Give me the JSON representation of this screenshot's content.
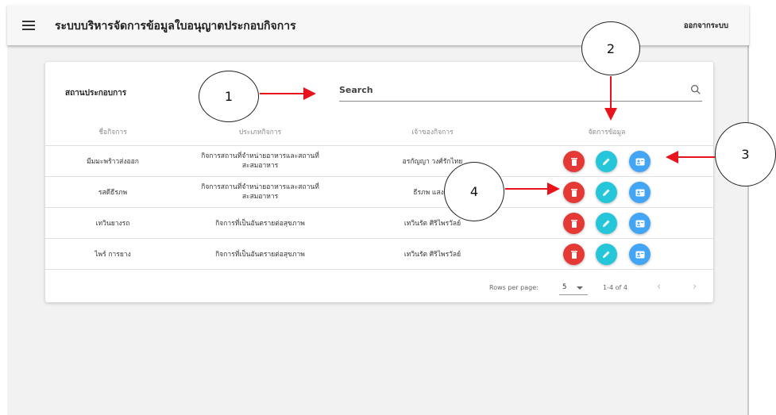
{
  "app": {
    "title": "ระบบบริหารจัดการข้อมูลใบอนุญาตประกอบกิจการ",
    "logout_label": "ออกจากระบบ"
  },
  "card": {
    "title": "สถานประกอบการ",
    "search_placeholder": "Search"
  },
  "table": {
    "headers": [
      "ชื่อกิจการ",
      "ประเภทกิจการ",
      "เจ้าของกิจการ",
      "จัดการข้อมูล"
    ],
    "rows": [
      {
        "name": "มีมมะพร้าวส่งออก",
        "type": "กิจการสถานที่จำหน่ายอาหารและสถานที่\nสะสมอาหาร",
        "owner": "อรกัญญา วงศ์รักไทย"
      },
      {
        "name": "รสดีธีรภพ",
        "type": "กิจการสถานที่จำหน่ายอาหารและสถานที่\nสะสมอาหาร",
        "owner": "ธีรภพ แสงศรี"
      },
      {
        "name": "เทวินยางรถ",
        "type": "กิจการที่เป็นอันตรายต่อสุขภาพ",
        "owner": "เทวินรัต ศิริไพรวัลย์"
      },
      {
        "name": "ไพร์ การยาง",
        "type": "กิจการที่เป็นอันตรายต่อสุขภาพ",
        "owner": "เทวินรัต ศิริไพรวัลย์"
      }
    ],
    "actions": {
      "delete_icon": "trash-icon",
      "edit_icon": "pencil-icon",
      "info_icon": "id-card-icon"
    }
  },
  "pagination": {
    "rows_per_page_label": "Rows per page:",
    "rows_per_page_value": "5",
    "range": "1-4 of 4"
  },
  "annotations": [
    "1",
    "2",
    "3",
    "4"
  ],
  "colors": {
    "delete": "#e53935",
    "edit": "#26c6da",
    "info": "#42a5f5",
    "arrow": "#e8141c"
  }
}
